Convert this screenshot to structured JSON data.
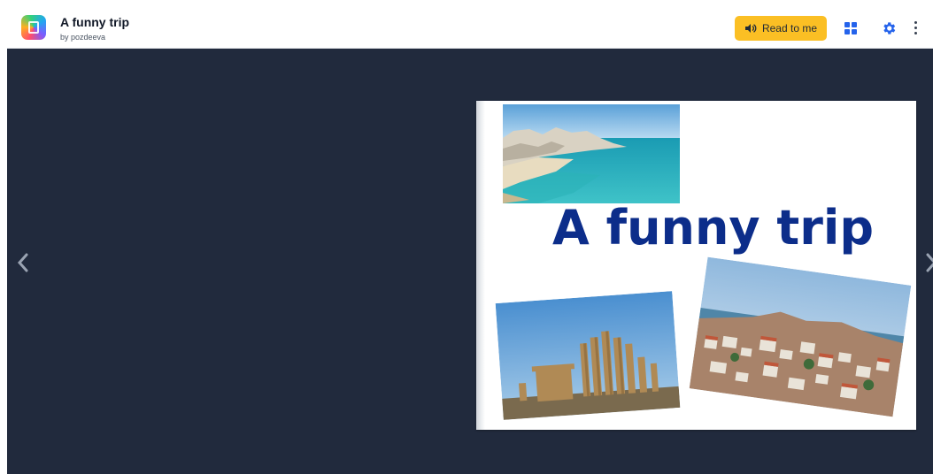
{
  "header": {
    "title": "A funny trip",
    "author": "by pozdeeva",
    "read_button_label": "Read to me",
    "icons": {
      "logo": "book-creator-logo",
      "read": "speaker-icon",
      "layout": "grid-icon",
      "settings": "gear-icon",
      "more": "more-vertical-icon"
    }
  },
  "reader": {
    "page": {
      "title": "A funny trip",
      "photos": [
        "beach-photo",
        "ruins-photo",
        "coastal-town-photo"
      ]
    },
    "nav": {
      "prev_icon": "chevron-left-icon",
      "next_icon": "chevron-right-icon"
    }
  },
  "colors": {
    "stage_background": "#212a3d",
    "accent": "#fbbf24",
    "title_blue": "#0c2d8a",
    "icon_blue": "#2563eb"
  }
}
